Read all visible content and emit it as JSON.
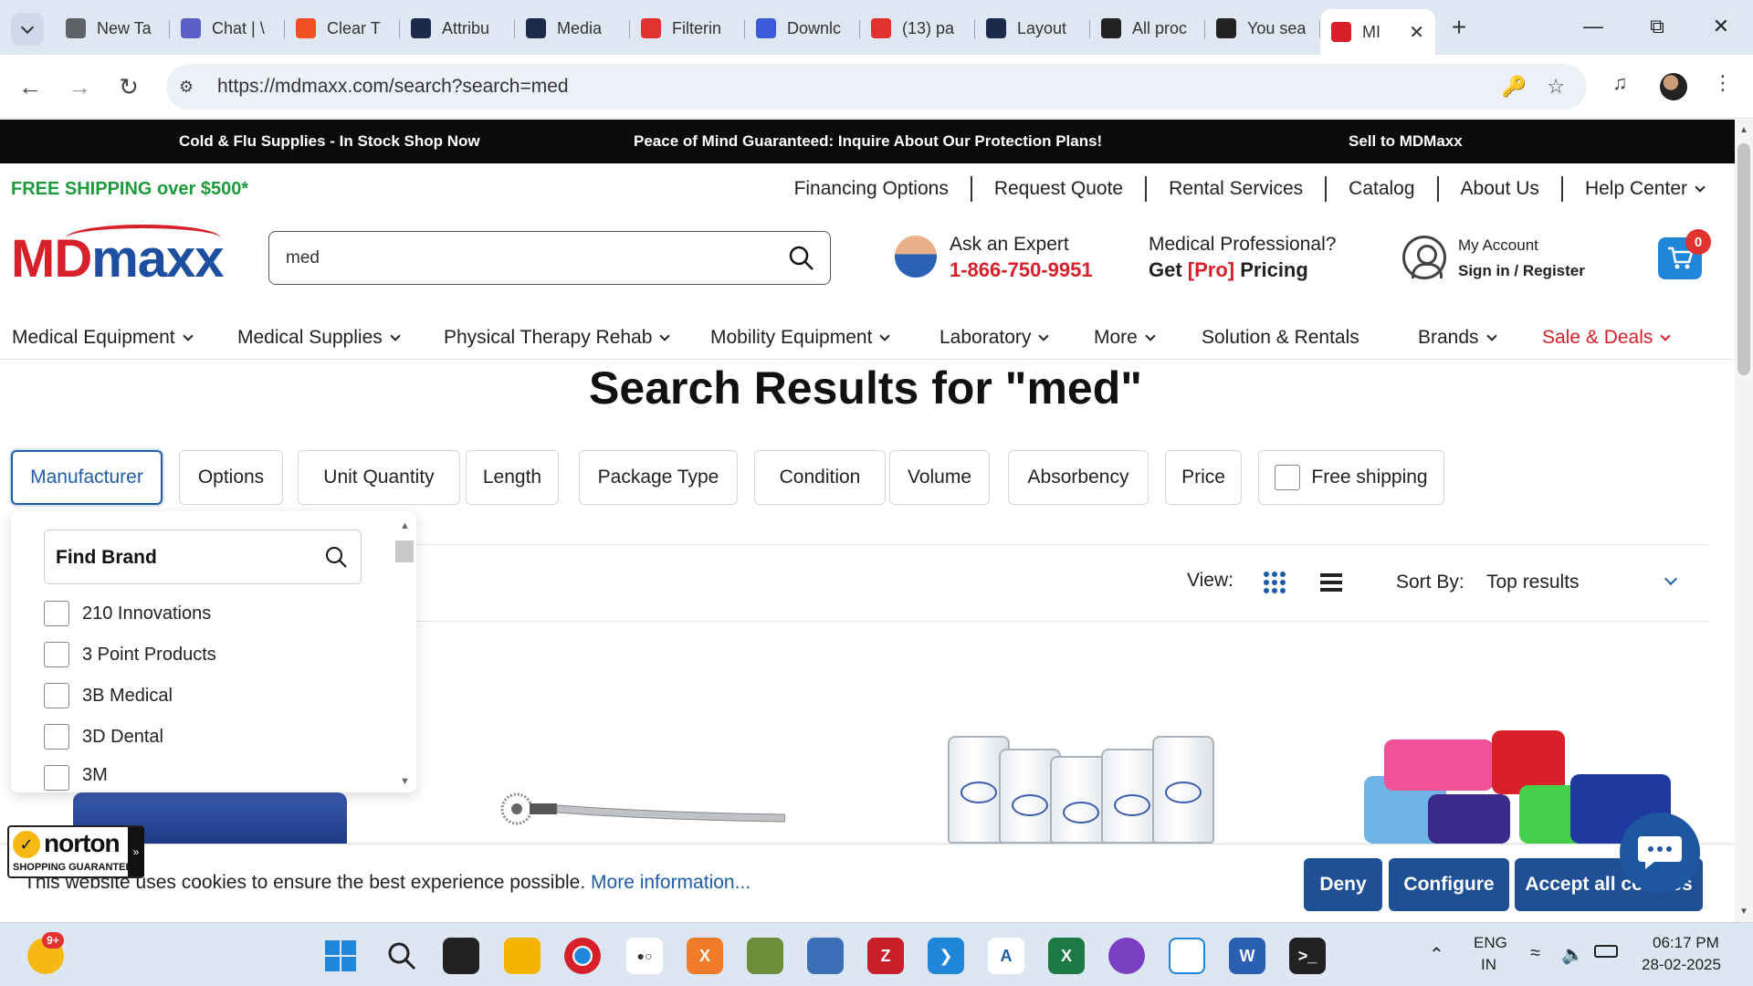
{
  "browser": {
    "tabs": [
      {
        "title": "New Ta",
        "icon": "chrome-icon",
        "color": "#5f6368"
      },
      {
        "title": "Chat | \\",
        "icon": "teams-icon",
        "color": "#5b5fc7"
      },
      {
        "title": "Clear T",
        "icon": "microsoft-icon",
        "color": "#f25022"
      },
      {
        "title": "Attribu",
        "icon": "app-icon",
        "color": "#1b2a4a"
      },
      {
        "title": "Media",
        "icon": "app-icon",
        "color": "#1b2a4a"
      },
      {
        "title": "Filterin",
        "icon": "x-icon",
        "color": "#e0322f"
      },
      {
        "title": "Downlc",
        "icon": "download-icon",
        "color": "#3b5bdb"
      },
      {
        "title": "(13) pa",
        "icon": "check-icon",
        "color": "#e0322f"
      },
      {
        "title": "Layout",
        "icon": "app-icon",
        "color": "#1b2a4a"
      },
      {
        "title": "All proc",
        "icon": "a-icon",
        "color": "#222"
      },
      {
        "title": "You sea",
        "icon": "a-icon",
        "color": "#222"
      },
      {
        "title": "MI",
        "icon": "mdmaxx-icon",
        "color": "#d8202a",
        "active": true
      }
    ],
    "url": "https://mdmaxx.com/search?search=med"
  },
  "promo": {
    "item1": "Cold & Flu Supplies - In Stock Shop Now",
    "item2": "Peace of Mind Guaranteed: Inquire About Our Protection Plans!",
    "item3": "Sell to MDMaxx"
  },
  "utility": {
    "free_shipping": "FREE SHIPPING over $500*",
    "links": [
      "Financing Options",
      "Request Quote",
      "Rental Services",
      "Catalog",
      "About Us",
      "Help Center"
    ]
  },
  "header": {
    "logo_md": "MD",
    "logo_maxx": "maxx",
    "search_value": "med",
    "expert_title": "Ask an Expert",
    "expert_phone": "1-866-750-9951",
    "pro_title": "Medical Professional?",
    "pro_prefix": "Get ",
    "pro_tag": "[Pro]",
    "pro_suffix": " Pricing",
    "account_title": "My Account",
    "account_sub": "Sign in / Register",
    "cart_count": "0"
  },
  "nav": [
    "Medical Equipment",
    "Medical Supplies",
    "Physical Therapy Rehab",
    "Mobility Equipment",
    "Laboratory",
    "More",
    "Solution & Rentals",
    "Brands",
    "Sale & Deals"
  ],
  "results": {
    "title": "Search Results for \"med\""
  },
  "filters": [
    "Manufacturer",
    "Options",
    "Unit Quantity",
    "Length",
    "Package Type",
    "Condition",
    "Volume",
    "Absorbency",
    "Price"
  ],
  "free_shipping_filter": "Free shipping",
  "brand_panel": {
    "search_label": "Find Brand",
    "brands": [
      "210 Innovations",
      "3 Point Products",
      "3B Medical",
      "3D Dental",
      "3M"
    ]
  },
  "toolbar": {
    "view_label": "View:",
    "sort_label": "Sort By:",
    "sort_value": "Top results"
  },
  "norton": {
    "name": "norton",
    "sub": "SHOPPING GUARANTEE"
  },
  "cookie": {
    "text": "This website uses cookies to ensure the best experience possible.",
    "link": "More information...",
    "deny": "Deny",
    "configure": "Configure",
    "accept": "Accept all cookies"
  },
  "taskbar": {
    "notif_badge": "9+",
    "lang1": "ENG",
    "lang2": "IN",
    "time": "06:17 PM",
    "date": "28-02-2025"
  },
  "colors": {
    "brand_red": "#d8202a",
    "brand_blue": "#1e4ea0",
    "accent_blue": "#1f5da8",
    "free_ship_green": "#1c9a3c",
    "cookie_btn": "#1f4f94"
  }
}
